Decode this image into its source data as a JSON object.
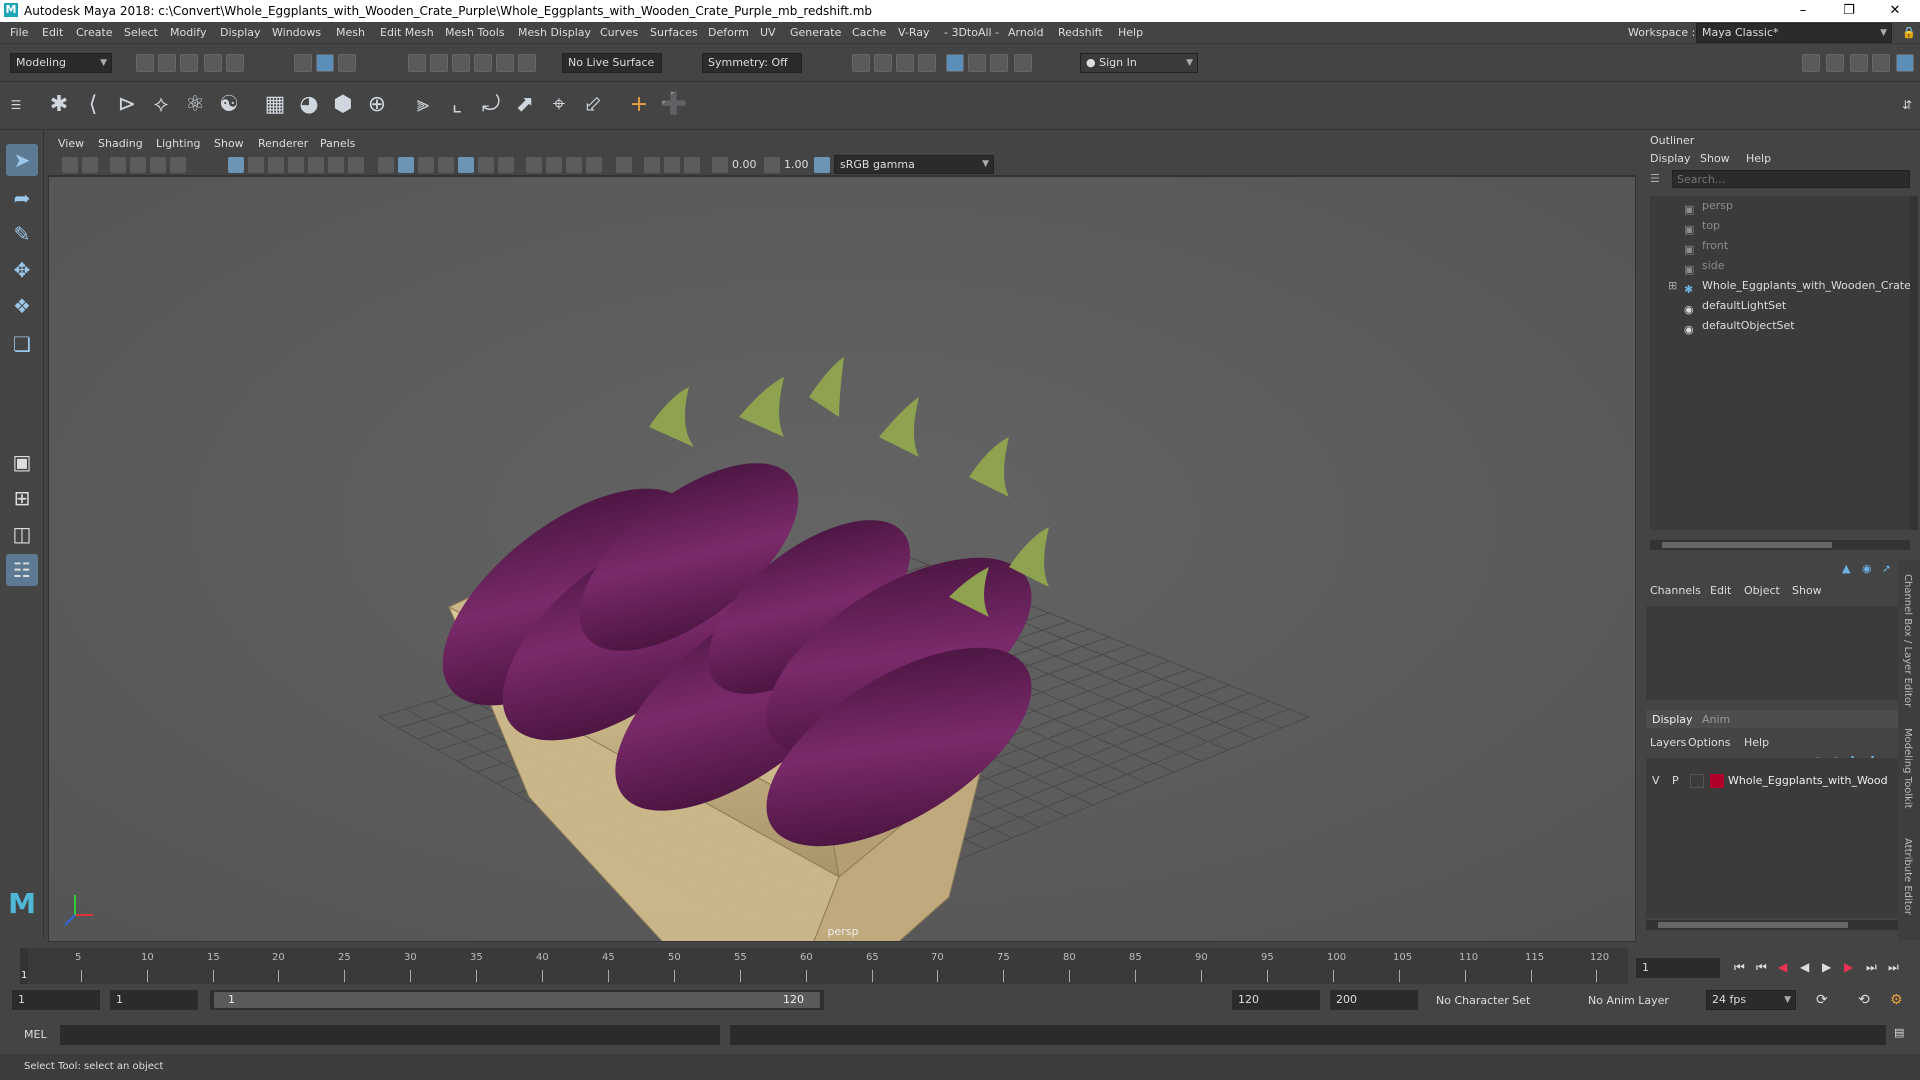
{
  "title": {
    "text": "Autodesk Maya 2018: c:\\Convert\\Whole_Eggplants_with_Wooden_Crate_Purple\\Whole_Eggplants_with_Wooden_Crate_Purple_mb_redshift.mb",
    "logo": "M",
    "min": "–",
    "max": "❐",
    "close": "✕"
  },
  "menu": [
    "File",
    "Edit",
    "Create",
    "Select",
    "Modify",
    "Display",
    "Windows",
    "Mesh",
    "Edit Mesh",
    "Mesh Tools",
    "Mesh Display",
    "Curves",
    "Surfaces",
    "Deform",
    "UV",
    "Generate",
    "Cache",
    "V-Ray",
    "- 3DtoAll -",
    "Arnold",
    "Redshift",
    "Help"
  ],
  "workspace": {
    "label": "Workspace :",
    "value": "Maya Classic*"
  },
  "status": {
    "mode": "Modeling",
    "live_surface": "No Live Surface",
    "symmetry": "Symmetry: Off",
    "sign_in": "Sign In"
  },
  "viewport": {
    "menu": [
      "View",
      "Shading",
      "Lighting",
      "Show",
      "Renderer",
      "Panels"
    ],
    "exposure": "0.00",
    "gamma": "1.00",
    "color_space": "sRGB gamma",
    "camera_label": "persp"
  },
  "outliner": {
    "title": "Outliner",
    "menu": [
      "Display",
      "Show",
      "Help"
    ],
    "search_placeholder": "Search...",
    "items": [
      {
        "label": "persp",
        "icon": "camera-icon",
        "dim": true
      },
      {
        "label": "top",
        "icon": "camera-icon",
        "dim": true
      },
      {
        "label": "front",
        "icon": "camera-icon",
        "dim": true
      },
      {
        "label": "side",
        "icon": "camera-icon",
        "dim": true
      },
      {
        "label": "Whole_Eggplants_with_Wooden_Crate_",
        "icon": "group-icon",
        "dim": false,
        "expandable": true
      },
      {
        "label": "defaultLightSet",
        "icon": "set-icon",
        "dim": false
      },
      {
        "label": "defaultObjectSet",
        "icon": "set-icon",
        "dim": false
      }
    ]
  },
  "channel_box": {
    "menu": [
      "Channels",
      "Edit",
      "Object",
      "Show"
    ],
    "tabs": [
      "Display",
      "Anim"
    ],
    "layer_menu": [
      "Layers",
      "Options",
      "Help"
    ],
    "layer": {
      "v": "V",
      "p": "P",
      "name": "Whole_Eggplants_with_Wood",
      "color": "#b0002a"
    }
  },
  "side_tabs": [
    "Channel Box / Layer Editor",
    "Modeling Toolkit",
    "Attribute Editor"
  ],
  "timeline": {
    "tick_labels": [
      "5",
      "10",
      "15",
      "20",
      "25",
      "30",
      "35",
      "40",
      "45",
      "50",
      "55",
      "60",
      "65",
      "70",
      "75",
      "80",
      "85",
      "90",
      "95",
      "100",
      "105",
      "110",
      "115",
      "120"
    ],
    "start_marker": "1",
    "current_frame": "1"
  },
  "range": {
    "start": "1",
    "anim_start": "1",
    "slider_start": "1",
    "slider_end": "120",
    "end": "120",
    "anim_end": "200",
    "character_set": "No Character Set",
    "anim_layer": "No Anim Layer",
    "fps": "24 fps"
  },
  "command": {
    "label": "MEL"
  },
  "help_line": "Select Tool: select an object",
  "colors": {
    "accent": "#5b8fb9",
    "eggplant": "#5a1a4a",
    "crate": "#c9b58a"
  }
}
